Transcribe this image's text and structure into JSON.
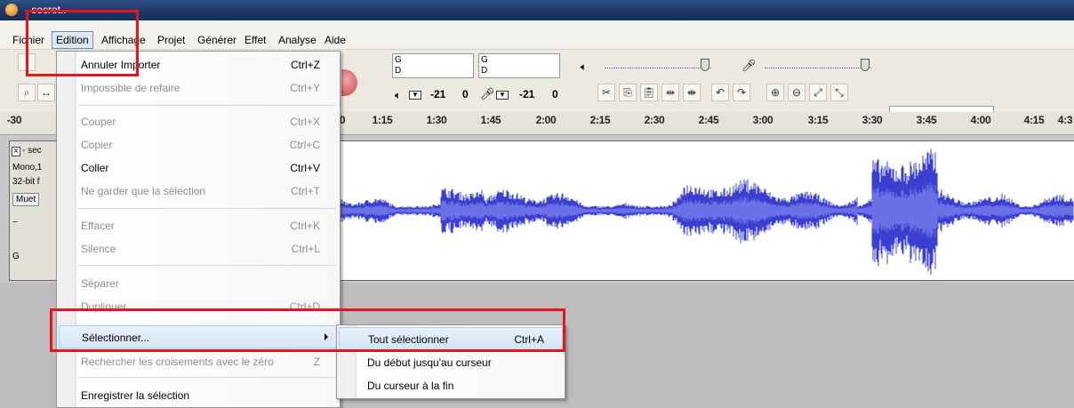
{
  "window": {
    "title": "- secret.."
  },
  "menubar": {
    "items": [
      "Fichier",
      "Edition",
      "Affichage",
      "Projet",
      "Générer",
      "Effet",
      "Analyse",
      "Aide"
    ]
  },
  "toolbar": {
    "meter_left_labels": [
      "G",
      "D"
    ],
    "meter_right_labels": [
      "G",
      "D"
    ],
    "db_left": "-21",
    "db_left_zero": "0",
    "db_right": "-21",
    "db_right_zero": "0"
  },
  "ruler": {
    "ticks": [
      "-30",
      "0",
      "1:15",
      "1:30",
      "1:45",
      "2:00",
      "2:15",
      "2:30",
      "2:45",
      "3:00",
      "3:15",
      "3:30",
      "3:45",
      "4:00",
      "4:15",
      "4:3"
    ]
  },
  "track": {
    "close": "×",
    "name": "- sec",
    "info1": "Mono,1",
    "info2": "32-bit f",
    "mute": "Muet",
    "gain_label": "G"
  },
  "edit_menu": {
    "items": [
      {
        "label": "Annuler Importer",
        "shortcut": "Ctrl+Z"
      },
      {
        "label": "Impossible de refaire",
        "shortcut": "Ctrl+Y"
      },
      {
        "label": "Couper",
        "shortcut": "Ctrl+X"
      },
      {
        "label": "Copier",
        "shortcut": "Ctrl+C"
      },
      {
        "label": "Coller",
        "shortcut": "Ctrl+V"
      },
      {
        "label": "Ne garder que la sélection",
        "shortcut": "Ctrl+T"
      },
      {
        "label": "Effacer",
        "shortcut": "Ctrl+K"
      },
      {
        "label": "Silence",
        "shortcut": "Ctrl+L"
      },
      {
        "label": "Séparer",
        "shortcut": ""
      },
      {
        "label": "Dupliquer",
        "shortcut": "Ctrl+D"
      },
      {
        "label": "Sélectionner...",
        "shortcut": ""
      },
      {
        "label": "Rechercher les croisements avec le zéro",
        "shortcut": "Z"
      },
      {
        "label": "Enregistrer la sélection",
        "shortcut": ""
      }
    ]
  },
  "select_submenu": {
    "items": [
      {
        "label": "Tout sélectionner",
        "shortcut": "Ctrl+A"
      },
      {
        "label": "Du début jusqu'au curseur",
        "shortcut": ""
      },
      {
        "label": "Du curseur à la fin",
        "shortcut": ""
      }
    ]
  },
  "colors": {
    "waveform": "#3b3fd0",
    "waveform_light": "#6c70e6",
    "highlight": "#e8141c"
  }
}
